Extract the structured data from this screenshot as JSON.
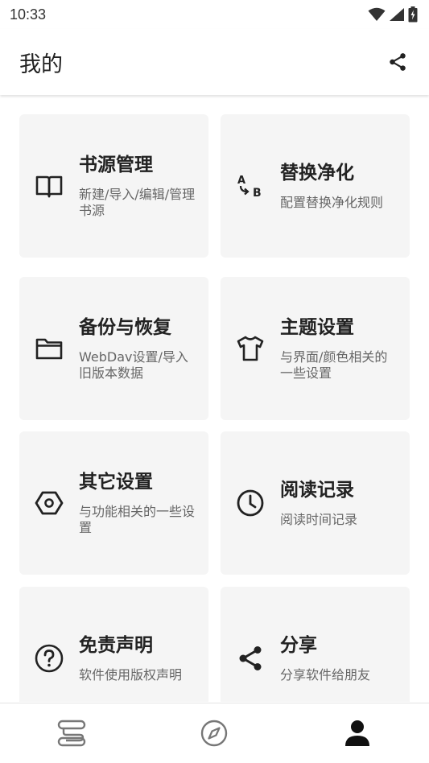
{
  "status_bar": {
    "time": "10:33",
    "icons": [
      "wifi-icon",
      "cell-signal-icon",
      "battery-charging-icon"
    ]
  },
  "header": {
    "title": "我的",
    "share_icon": "share-icon"
  },
  "cards": [
    {
      "title": "书源管理",
      "desc": "新建/导入/编辑/管理书源",
      "icon": "book-icon"
    },
    {
      "title": "替换净化",
      "desc": "配置替换净化规则",
      "icon": "replace-ab-icon"
    },
    {
      "title": "备份与恢复",
      "desc": "WebDav设置/导入旧版本数据",
      "icon": "folder-icon"
    },
    {
      "title": "主题设置",
      "desc": "与界面/颜色相关的一些设置",
      "icon": "tshirt-icon"
    },
    {
      "title": "其它设置",
      "desc": "与功能相关的一些设置",
      "icon": "settings-hex-icon"
    },
    {
      "title": "阅读记录",
      "desc": "阅读时间记录",
      "icon": "clock-icon"
    },
    {
      "title": "免责声明",
      "desc": "软件使用版权声明",
      "icon": "help-circle-icon"
    },
    {
      "title": "分享",
      "desc": "分享软件给朋友",
      "icon": "share-icon"
    }
  ],
  "bottom_nav": {
    "items": [
      "bookshelf-icon",
      "explore-compass-icon",
      "profile-person-icon"
    ],
    "active": "profile-person-icon"
  }
}
